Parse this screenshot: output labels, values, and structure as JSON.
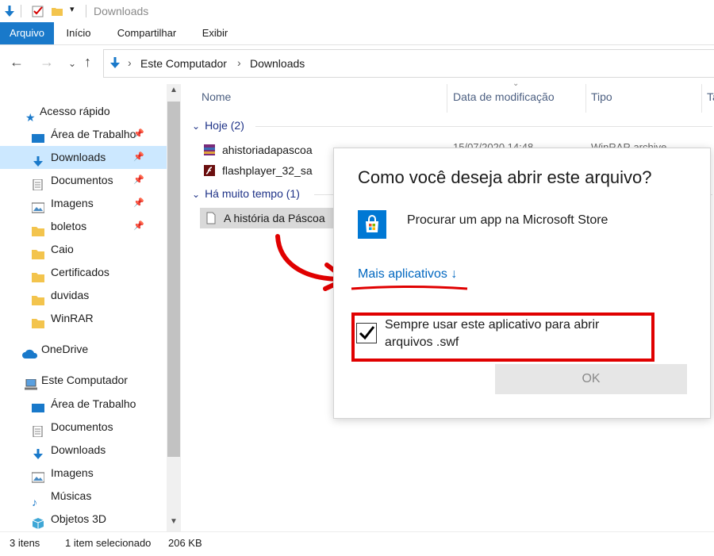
{
  "window": {
    "title": "Downloads"
  },
  "ribbon": {
    "tabs": [
      "Arquivo",
      "Início",
      "Compartilhar",
      "Exibir"
    ]
  },
  "address": {
    "crumbs": [
      "Este Computador",
      "Downloads"
    ]
  },
  "sidebar": {
    "quick_access": "Acesso rápido",
    "quick_items": [
      "Área de Trabalho",
      "Downloads",
      "Documentos",
      "Imagens",
      "boletos",
      "Caio",
      "Certificados",
      "duvidas",
      "WinRAR"
    ],
    "onedrive": "OneDrive",
    "computer": "Este Computador",
    "computer_items": [
      "Área de Trabalho",
      "Documentos",
      "Downloads",
      "Imagens",
      "Músicas",
      "Objetos 3D"
    ]
  },
  "columns": {
    "name": "Nome",
    "date": "Data de modificação",
    "type": "Tipo",
    "size": "Ta"
  },
  "groups": {
    "today": "Hoje (2)",
    "old": "Há muito tempo (1)"
  },
  "files": {
    "f1": {
      "name": "ahistoriadapascoa",
      "date": "15/07/2020 14:48",
      "type": "WinRAR archive"
    },
    "f2": {
      "name": "flashplayer_32_sa"
    },
    "f3": {
      "name": "A história da Páscoa"
    }
  },
  "status": {
    "count": "3 itens",
    "selected": "1 item selecionado",
    "size": "206 KB"
  },
  "dialog": {
    "title": "Como você deseja abrir este arquivo?",
    "store": "Procurar um app na Microsoft Store",
    "more": "Mais aplicativos",
    "more_arrow": "↓",
    "always": "Sempre usar este aplicativo para abrir arquivos .swf",
    "always_checked": true,
    "ok": "OK"
  },
  "colors": {
    "accent": "#1979ca",
    "link": "#0067c0",
    "highlight_red": "#e00000"
  }
}
